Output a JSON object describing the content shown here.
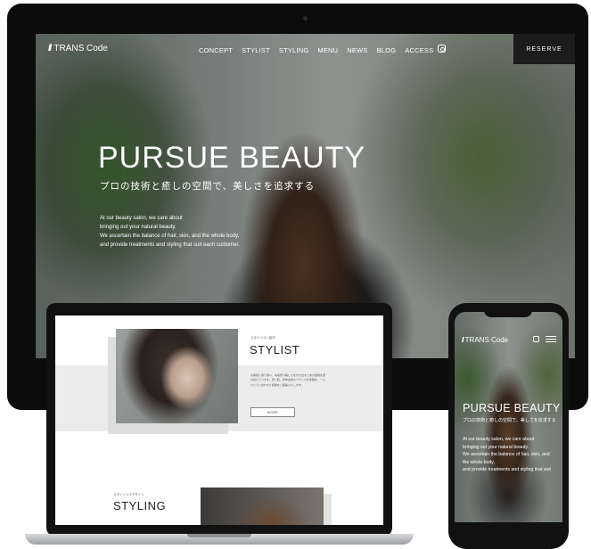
{
  "desktop": {
    "logo": {
      "mark": "///",
      "text": "TRANS Code"
    },
    "nav": [
      "CONCEPT",
      "STYLIST",
      "STYLING",
      "MENU",
      "NEWS",
      "BLOG",
      "ACCESS"
    ],
    "instagram_icon": "instagram-icon",
    "reserve_label": "RESERVE",
    "hero": {
      "title": "PURSUE BEAUTY",
      "subtitle": "プロの技術と癒しの空間で、美しさを追求する",
      "body": [
        "At our beauty salon, we care about",
        "bringing out your natural beauty.",
        "We ascertain the balance of hair, skin, and the whole body,",
        "and provide treatments and styling that suit each customer."
      ]
    }
  },
  "laptop": {
    "stylist_subtitle": "スタイリスト紹介",
    "stylist_title": "STYLIST",
    "stylist_body": "お客様に寄り添い、本来持つ美しさを引き出すための技術を磨き続けています。髪と肌、身体全体のバランスを見極め、一人ひとりに合わせた施術をご提案いたします。",
    "more_label": "MORE",
    "styling_subtitle": "スタイリングデザイン",
    "styling_title": "STYLING"
  },
  "phone": {
    "logo": {
      "mark": "///",
      "text": "TRANS Code"
    },
    "instagram_icon": "instagram-icon",
    "menu_icon": "hamburger-menu-icon",
    "hero": {
      "title": "PURSUE BEAUTY",
      "subtitle": "プロの技術と癒しの空間で、美しさを追求する",
      "body": [
        "At our beauty salon, we care about",
        "bringing out your natural beauty.",
        "We ascertain the balance of hair, skin, and",
        "the whole body,",
        "and provide treatments and styling that suit"
      ]
    }
  }
}
